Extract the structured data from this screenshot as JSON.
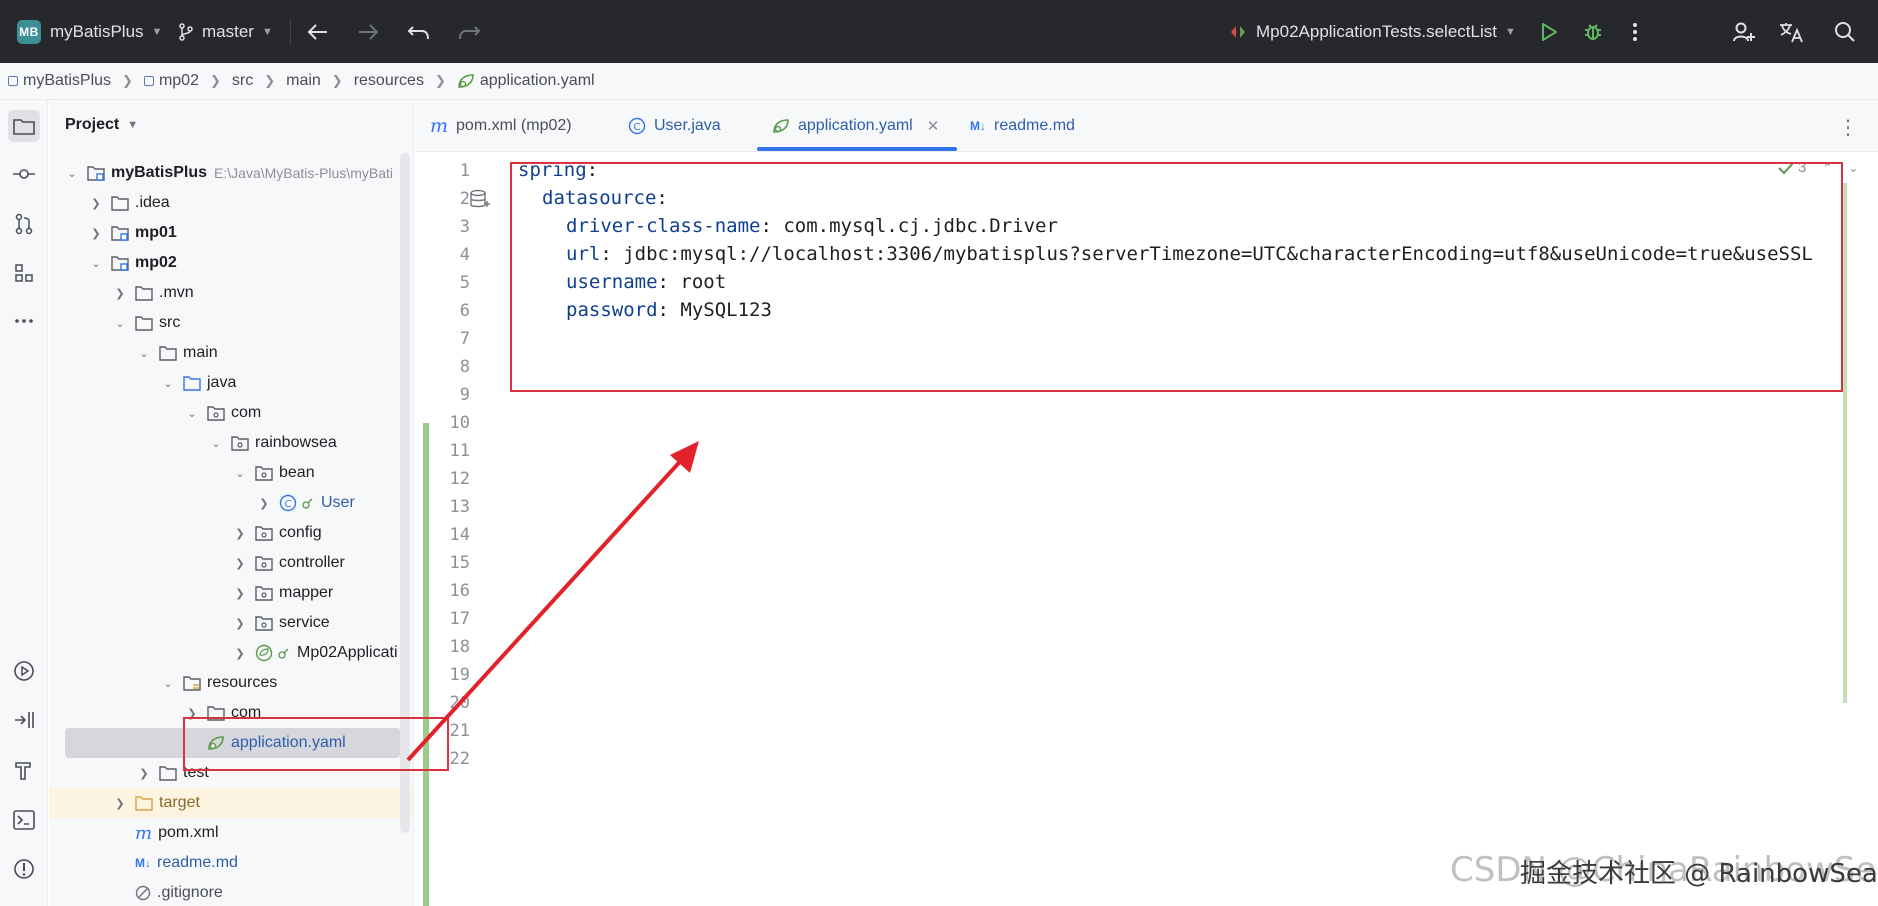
{
  "titlebar": {
    "project_badge": "MB",
    "project_name": "myBatisPlus",
    "branch": "master",
    "run_config": "Mp02ApplicationTests.selectList"
  },
  "breadcrumb": [
    "myBatisPlus",
    "mp02",
    "src",
    "main",
    "resources",
    "application.yaml"
  ],
  "project_panel": {
    "title": "Project",
    "tree": [
      {
        "label": "myBatisPlus",
        "path": "E:\\Java\\MyBatis-Plus\\myBati"
      },
      {
        "label": ".idea"
      },
      {
        "label": "mp01"
      },
      {
        "label": "mp02"
      },
      {
        "label": ".mvn"
      },
      {
        "label": "src"
      },
      {
        "label": "main"
      },
      {
        "label": "java"
      },
      {
        "label": "com"
      },
      {
        "label": "rainbowsea"
      },
      {
        "label": "bean"
      },
      {
        "label": "User"
      },
      {
        "label": "config"
      },
      {
        "label": "controller"
      },
      {
        "label": "mapper"
      },
      {
        "label": "service"
      },
      {
        "label": "Mp02Applicati"
      },
      {
        "label": "resources"
      },
      {
        "label": "com"
      },
      {
        "label": "application.yaml"
      },
      {
        "label": "test"
      },
      {
        "label": "target"
      },
      {
        "label": "pom.xml"
      },
      {
        "label": "readme.md"
      },
      {
        "label": ".gitignore"
      }
    ]
  },
  "tabs": [
    {
      "label": "pom.xml (mp02)"
    },
    {
      "label": "User.java"
    },
    {
      "label": "application.yaml"
    },
    {
      "label": "readme.md"
    }
  ],
  "editor": {
    "line_numbers": [
      "1",
      "2",
      "3",
      "4",
      "5",
      "6",
      "7",
      "8",
      "9",
      "10",
      "11",
      "12",
      "13",
      "14",
      "15",
      "16",
      "17",
      "18",
      "19",
      "20",
      "21",
      "22"
    ],
    "inspection_count": "3",
    "lines": [
      {
        "key": "spring",
        "value": ""
      },
      {
        "key": "datasource",
        "value": ""
      },
      {
        "key": "driver-class-name",
        "value": "com.mysql.cj.jdbc.Driver"
      },
      {
        "key": "url",
        "value": "jdbc:mysql://localhost:3306/mybatisplus?serverTimezone=UTC&characterEncoding=utf8&useUnicode=true&useSSL"
      },
      {
        "key": "username",
        "value": "root"
      },
      {
        "key": "password",
        "value": "MySQL123"
      }
    ]
  },
  "watermark": "CSDN @ChinaRainbowSea",
  "watermark_overlay": "掘金技术社区 @ RainbowSea",
  "colors": {
    "annotation_red": "#d9333f",
    "titlebar_bg": "#27282c",
    "yaml_key": "#0f3f8f",
    "active_tab_underline": "#3574f0"
  }
}
